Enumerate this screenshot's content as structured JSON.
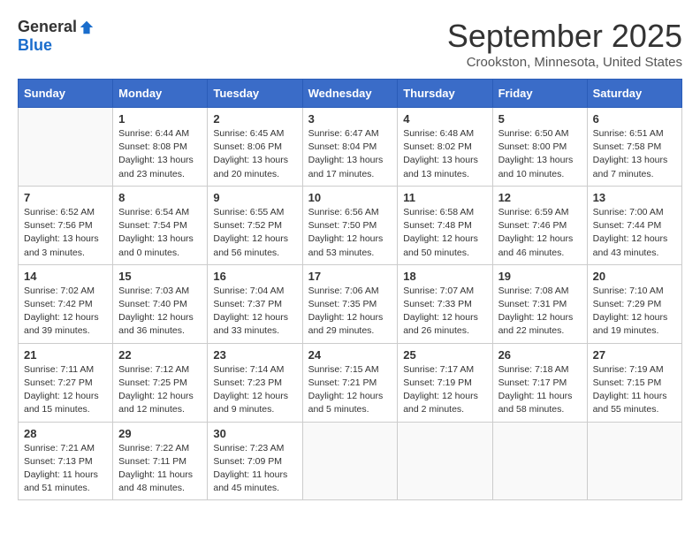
{
  "logo": {
    "general": "General",
    "blue": "Blue"
  },
  "title": "September 2025",
  "location": "Crookston, Minnesota, United States",
  "days_header": [
    "Sunday",
    "Monday",
    "Tuesday",
    "Wednesday",
    "Thursday",
    "Friday",
    "Saturday"
  ],
  "weeks": [
    [
      {
        "day": "",
        "info": ""
      },
      {
        "day": "1",
        "info": "Sunrise: 6:44 AM\nSunset: 8:08 PM\nDaylight: 13 hours\nand 23 minutes."
      },
      {
        "day": "2",
        "info": "Sunrise: 6:45 AM\nSunset: 8:06 PM\nDaylight: 13 hours\nand 20 minutes."
      },
      {
        "day": "3",
        "info": "Sunrise: 6:47 AM\nSunset: 8:04 PM\nDaylight: 13 hours\nand 17 minutes."
      },
      {
        "day": "4",
        "info": "Sunrise: 6:48 AM\nSunset: 8:02 PM\nDaylight: 13 hours\nand 13 minutes."
      },
      {
        "day": "5",
        "info": "Sunrise: 6:50 AM\nSunset: 8:00 PM\nDaylight: 13 hours\nand 10 minutes."
      },
      {
        "day": "6",
        "info": "Sunrise: 6:51 AM\nSunset: 7:58 PM\nDaylight: 13 hours\nand 7 minutes."
      }
    ],
    [
      {
        "day": "7",
        "info": "Sunrise: 6:52 AM\nSunset: 7:56 PM\nDaylight: 13 hours\nand 3 minutes."
      },
      {
        "day": "8",
        "info": "Sunrise: 6:54 AM\nSunset: 7:54 PM\nDaylight: 13 hours\nand 0 minutes."
      },
      {
        "day": "9",
        "info": "Sunrise: 6:55 AM\nSunset: 7:52 PM\nDaylight: 12 hours\nand 56 minutes."
      },
      {
        "day": "10",
        "info": "Sunrise: 6:56 AM\nSunset: 7:50 PM\nDaylight: 12 hours\nand 53 minutes."
      },
      {
        "day": "11",
        "info": "Sunrise: 6:58 AM\nSunset: 7:48 PM\nDaylight: 12 hours\nand 50 minutes."
      },
      {
        "day": "12",
        "info": "Sunrise: 6:59 AM\nSunset: 7:46 PM\nDaylight: 12 hours\nand 46 minutes."
      },
      {
        "day": "13",
        "info": "Sunrise: 7:00 AM\nSunset: 7:44 PM\nDaylight: 12 hours\nand 43 minutes."
      }
    ],
    [
      {
        "day": "14",
        "info": "Sunrise: 7:02 AM\nSunset: 7:42 PM\nDaylight: 12 hours\nand 39 minutes."
      },
      {
        "day": "15",
        "info": "Sunrise: 7:03 AM\nSunset: 7:40 PM\nDaylight: 12 hours\nand 36 minutes."
      },
      {
        "day": "16",
        "info": "Sunrise: 7:04 AM\nSunset: 7:37 PM\nDaylight: 12 hours\nand 33 minutes."
      },
      {
        "day": "17",
        "info": "Sunrise: 7:06 AM\nSunset: 7:35 PM\nDaylight: 12 hours\nand 29 minutes."
      },
      {
        "day": "18",
        "info": "Sunrise: 7:07 AM\nSunset: 7:33 PM\nDaylight: 12 hours\nand 26 minutes."
      },
      {
        "day": "19",
        "info": "Sunrise: 7:08 AM\nSunset: 7:31 PM\nDaylight: 12 hours\nand 22 minutes."
      },
      {
        "day": "20",
        "info": "Sunrise: 7:10 AM\nSunset: 7:29 PM\nDaylight: 12 hours\nand 19 minutes."
      }
    ],
    [
      {
        "day": "21",
        "info": "Sunrise: 7:11 AM\nSunset: 7:27 PM\nDaylight: 12 hours\nand 15 minutes."
      },
      {
        "day": "22",
        "info": "Sunrise: 7:12 AM\nSunset: 7:25 PM\nDaylight: 12 hours\nand 12 minutes."
      },
      {
        "day": "23",
        "info": "Sunrise: 7:14 AM\nSunset: 7:23 PM\nDaylight: 12 hours\nand 9 minutes."
      },
      {
        "day": "24",
        "info": "Sunrise: 7:15 AM\nSunset: 7:21 PM\nDaylight: 12 hours\nand 5 minutes."
      },
      {
        "day": "25",
        "info": "Sunrise: 7:17 AM\nSunset: 7:19 PM\nDaylight: 12 hours\nand 2 minutes."
      },
      {
        "day": "26",
        "info": "Sunrise: 7:18 AM\nSunset: 7:17 PM\nDaylight: 11 hours\nand 58 minutes."
      },
      {
        "day": "27",
        "info": "Sunrise: 7:19 AM\nSunset: 7:15 PM\nDaylight: 11 hours\nand 55 minutes."
      }
    ],
    [
      {
        "day": "28",
        "info": "Sunrise: 7:21 AM\nSunset: 7:13 PM\nDaylight: 11 hours\nand 51 minutes."
      },
      {
        "day": "29",
        "info": "Sunrise: 7:22 AM\nSunset: 7:11 PM\nDaylight: 11 hours\nand 48 minutes."
      },
      {
        "day": "30",
        "info": "Sunrise: 7:23 AM\nSunset: 7:09 PM\nDaylight: 11 hours\nand 45 minutes."
      },
      {
        "day": "",
        "info": ""
      },
      {
        "day": "",
        "info": ""
      },
      {
        "day": "",
        "info": ""
      },
      {
        "day": "",
        "info": ""
      }
    ]
  ]
}
